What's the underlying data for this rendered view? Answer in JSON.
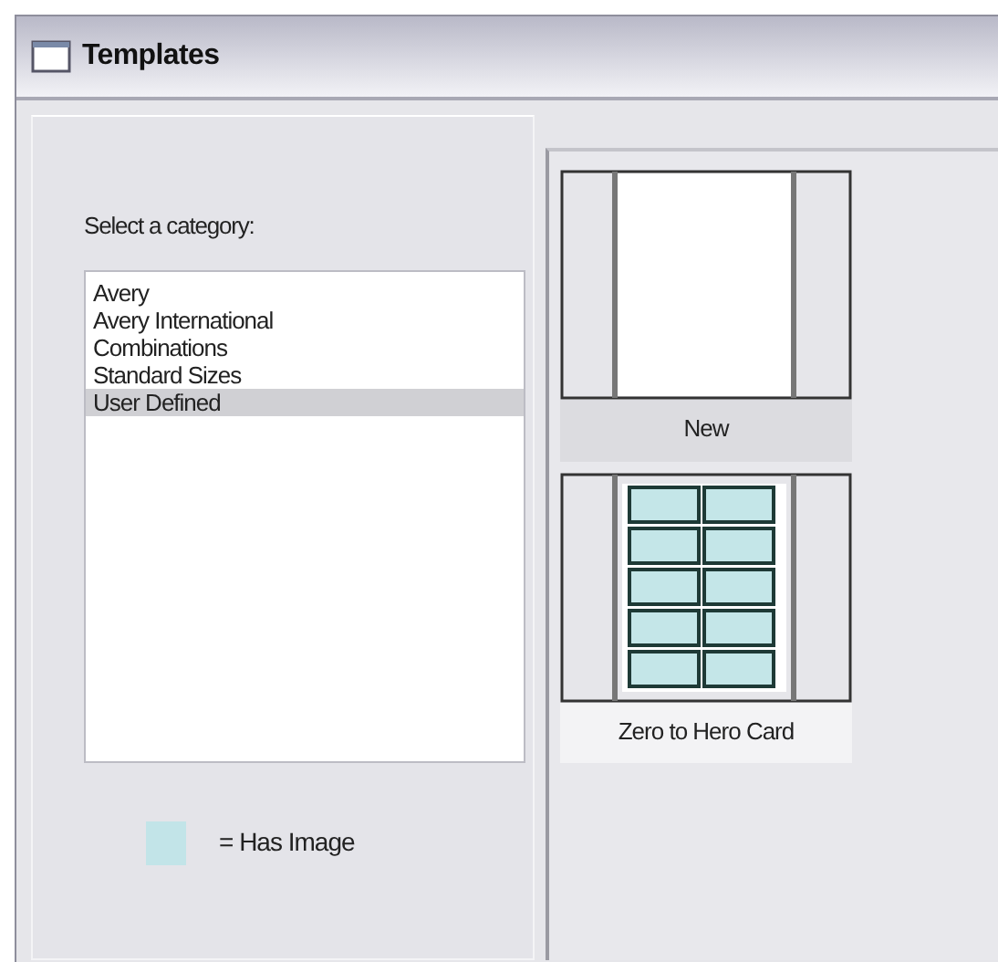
{
  "window": {
    "title": "Templates"
  },
  "category_prompt": "Select a category:",
  "categories": [
    {
      "label": "Avery",
      "selected": false
    },
    {
      "label": "Avery International",
      "selected": false
    },
    {
      "label": "Combinations",
      "selected": false
    },
    {
      "label": "Standard Sizes",
      "selected": false
    },
    {
      "label": "User Defined",
      "selected": true
    }
  ],
  "legend": {
    "text": "= Has Image"
  },
  "templates": [
    {
      "kind": "blank",
      "label": "New"
    },
    {
      "kind": "grid",
      "label": "Zero to Hero Card"
    }
  ]
}
